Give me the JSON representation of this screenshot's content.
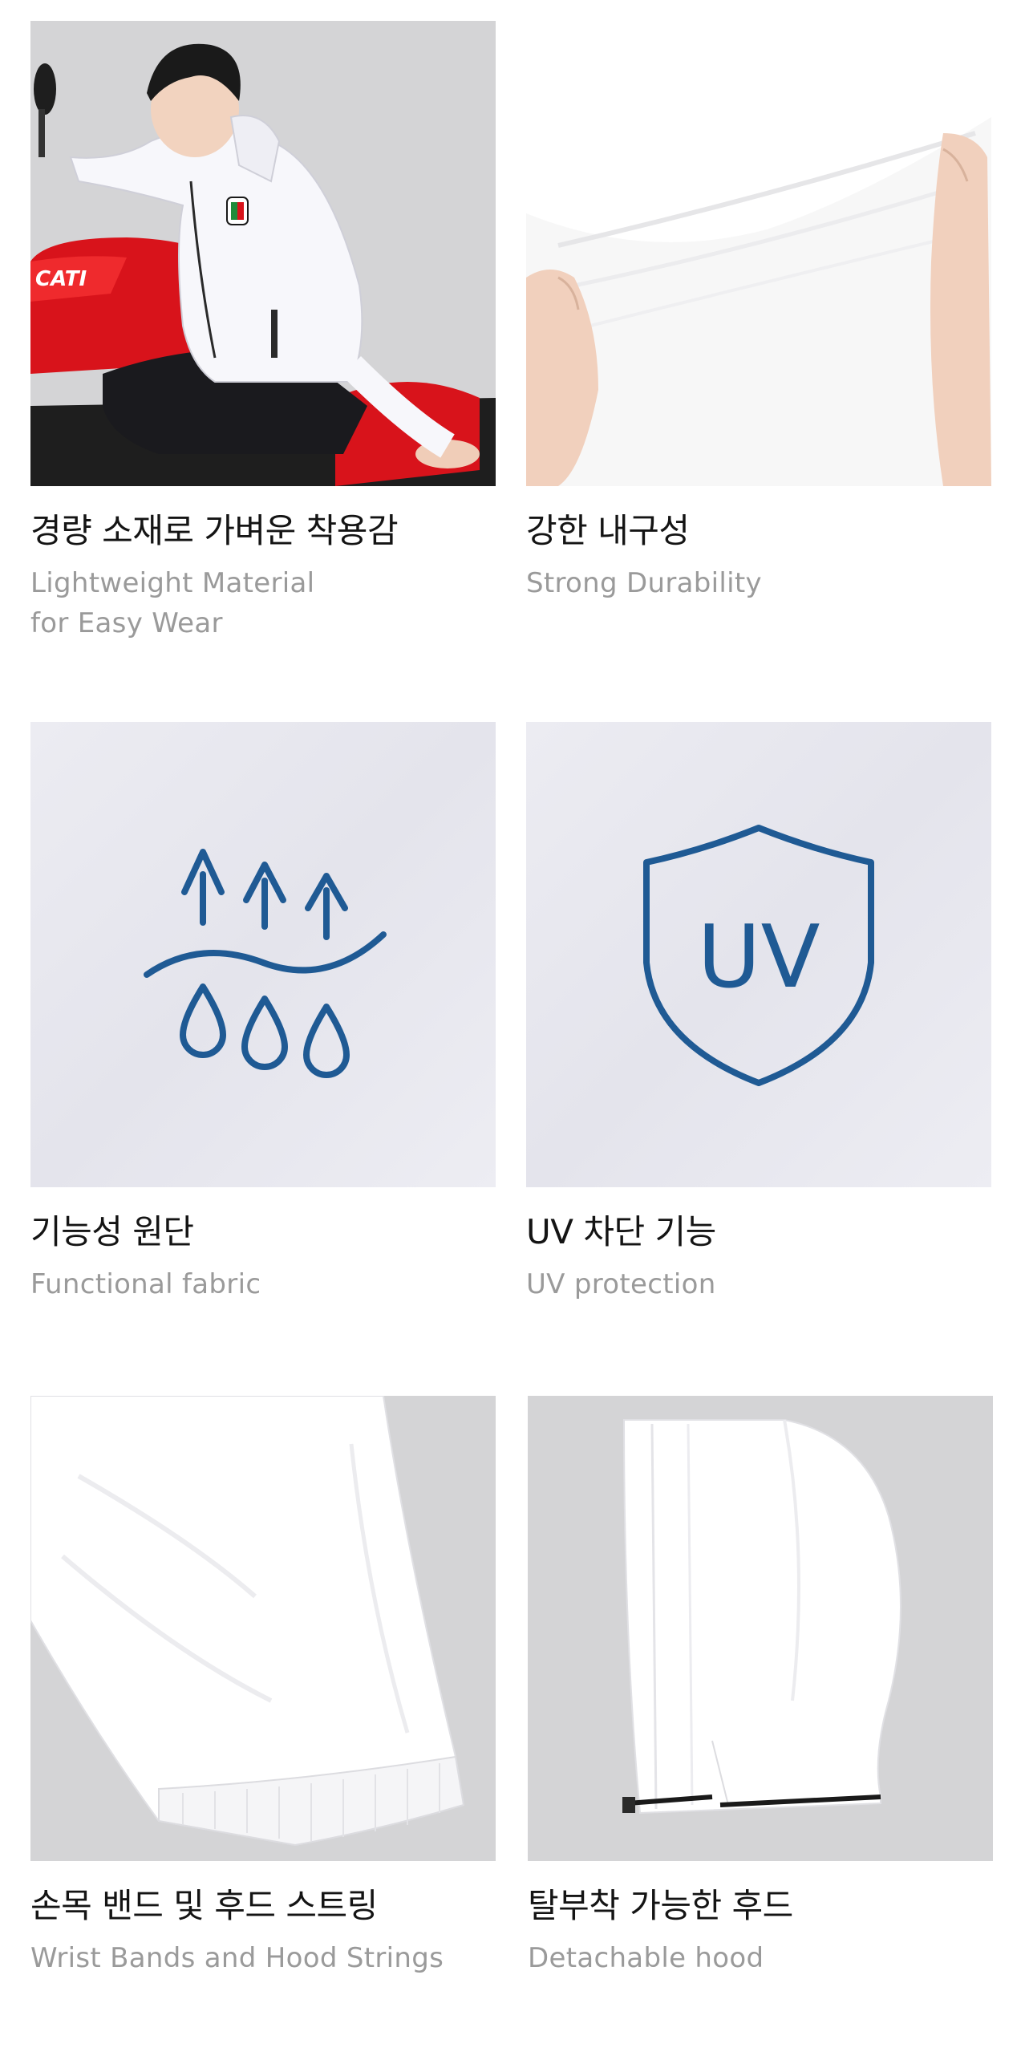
{
  "features": [
    {
      "title": "경량 소재로 가벼운 착용감",
      "subtitle": "Lightweight Material\nfor Easy Wear",
      "image": "rider-on-motorcycle-photo"
    },
    {
      "title": "강한 내구성",
      "subtitle": "Strong Durability",
      "image": "fabric-stretch-photo"
    },
    {
      "title": "기능성 원단",
      "subtitle": "Functional fabric",
      "image": "breathable-fabric-icon"
    },
    {
      "title": "UV 차단 기능",
      "subtitle": "UV protection",
      "image": "uv-shield-icon",
      "icon_text": "UV"
    },
    {
      "title": "손목 밴드 및 후드 스트링",
      "subtitle": "Wrist Bands and Hood Strings",
      "image": "wrist-band-sleeve-photo"
    },
    {
      "title": "탈부착 가능한 후드",
      "subtitle": "Detachable hood",
      "image": "detachable-hood-photo"
    }
  ],
  "colors": {
    "icon_blue": "#1f5a94",
    "photo_grey_bg": "#d4d4d6",
    "motorcycle_red": "#d8131b",
    "title_text": "#141414",
    "subtitle_text": "#9a9a9a"
  }
}
